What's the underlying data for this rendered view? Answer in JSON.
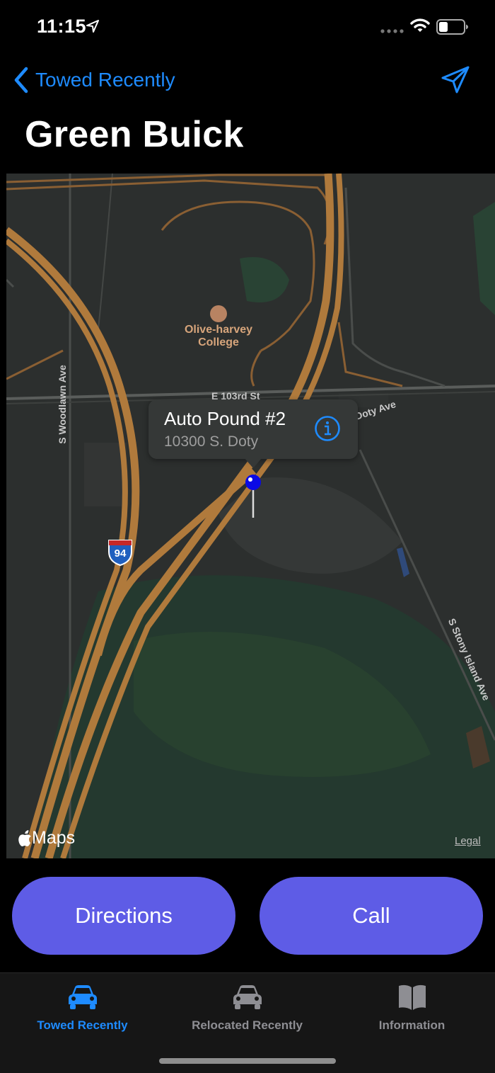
{
  "status_bar": {
    "time": "11:15",
    "icons": [
      "location-arrow-icon",
      "cellular-signal-icon",
      "wifi-icon",
      "battery-icon"
    ]
  },
  "nav": {
    "back_label": "Towed Recently",
    "back_icon": "chevron-left-icon",
    "right_icon": "send-location-icon"
  },
  "page_title": "Green Buick",
  "map": {
    "labels": {
      "college": "Olive-harvey College",
      "street_103rd": "E 103rd St",
      "doty_ave": "Doty Ave",
      "woodlawn": "S Woodlawn Ave",
      "stony_island": "S Stony Island Ave",
      "interstate": "94"
    },
    "callout": {
      "title": "Auto Pound #2",
      "subtitle": "10300 S. Doty",
      "icon": "info-icon"
    },
    "attribution": "Maps",
    "legal": "Legal",
    "colors": {
      "road": "#b07a3c",
      "pin": "#0a0ae6",
      "accent": "#1e8bff"
    }
  },
  "actions": {
    "directions_label": "Directions",
    "call_label": "Call",
    "button_color": "#5e5ce6"
  },
  "tabs": [
    {
      "label": "Towed Recently",
      "icon": "car-icon",
      "active": true
    },
    {
      "label": "Relocated Recently",
      "icon": "car-icon",
      "active": false
    },
    {
      "label": "Information",
      "icon": "book-icon",
      "active": false
    }
  ]
}
